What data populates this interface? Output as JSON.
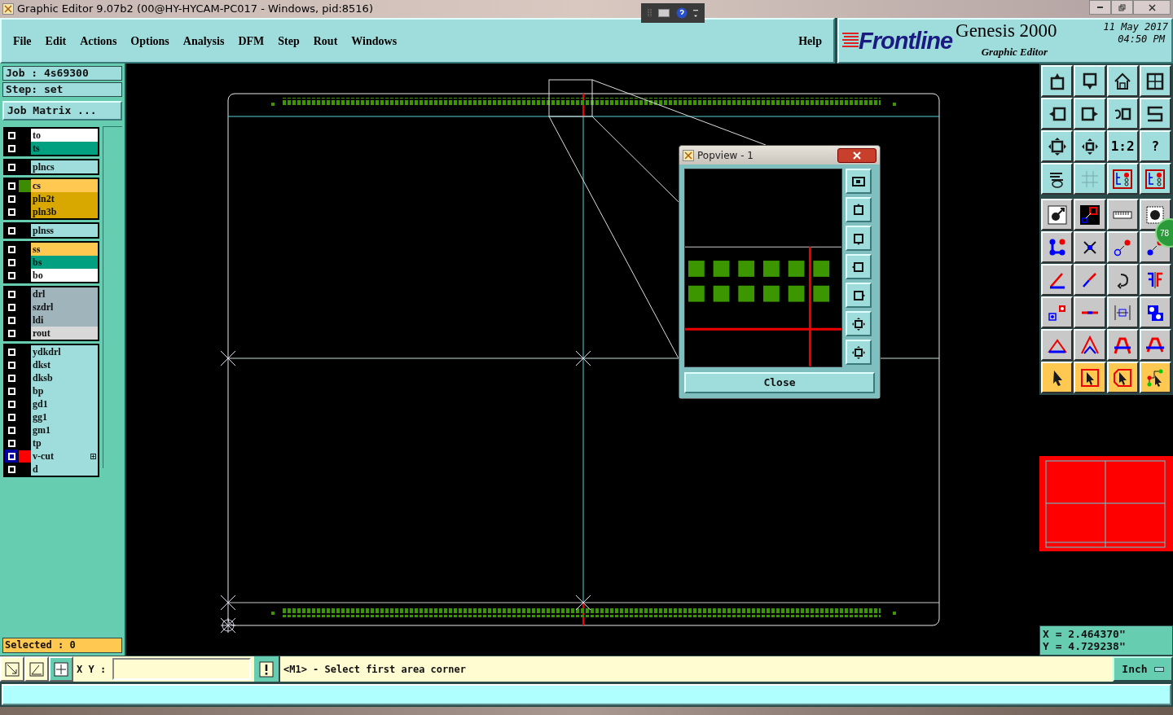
{
  "title_bar": {
    "title": "Graphic Editor 9.07b2 (00@HY-HYCAM-PC017 - Windows, pid:8516)"
  },
  "menu": {
    "items": [
      "File",
      "Edit",
      "Actions",
      "Options",
      "Analysis",
      "DFM",
      "Step",
      "Rout",
      "Windows"
    ],
    "help": "Help"
  },
  "brand": {
    "logo": "Frontline",
    "product": "Genesis 2000",
    "subtitle": "Graphic Editor",
    "date": "11 May 2017",
    "time": "04:50 PM"
  },
  "job": {
    "job": "Job : 4s69300",
    "step": "Step: set",
    "matrix_button": "Job Matrix ..."
  },
  "layer_groups": [
    {
      "layers": [
        {
          "name": "to",
          "color": "#ffffff",
          "displayed": false,
          "affected": false
        },
        {
          "name": "ts",
          "color": "#00a080",
          "displayed": false,
          "affected": false
        }
      ]
    },
    {
      "layers": [
        {
          "name": "plncs",
          "color": "#9fdcdc",
          "displayed": false,
          "affected": false
        }
      ]
    },
    {
      "layers": [
        {
          "name": "cs",
          "color": "#ffc850",
          "displayed": true,
          "swatch": {
            "color": "#3c8c00"
          },
          "affected": false
        },
        {
          "name": "pln2t",
          "color": "#d8a800",
          "displayed": false,
          "affected": false
        },
        {
          "name": "pln3b",
          "color": "#d8a800",
          "displayed": false,
          "affected": false
        }
      ]
    },
    {
      "layers": [
        {
          "name": "plnss",
          "color": "#9fdcdc",
          "displayed": false,
          "affected": false
        }
      ]
    },
    {
      "layers": [
        {
          "name": "ss",
          "color": "#ffc850",
          "displayed": false,
          "affected": false
        },
        {
          "name": "bs",
          "color": "#00a080",
          "displayed": false,
          "affected": false
        },
        {
          "name": "bo",
          "color": "#ffffff",
          "displayed": false,
          "affected": false
        }
      ]
    },
    {
      "layers": [
        {
          "name": "drl",
          "color": "#a0b4bc",
          "displayed": false,
          "affected": false
        },
        {
          "name": "szdrl",
          "color": "#a0b4bc",
          "displayed": false,
          "affected": false
        },
        {
          "name": "ldi",
          "color": "#a0b4bc",
          "displayed": false,
          "affected": false
        },
        {
          "name": "rout",
          "color": "#d8d8d8",
          "displayed": false,
          "affected": false
        }
      ]
    },
    {
      "layers": [
        {
          "name": "ydkdrl",
          "color": "#9fdcdc",
          "displayed": false,
          "affected": false
        },
        {
          "name": "dkst",
          "color": "#9fdcdc",
          "displayed": false,
          "affected": false
        },
        {
          "name": "dksb",
          "color": "#9fdcdc",
          "displayed": false,
          "affected": false
        },
        {
          "name": "bp",
          "color": "#9fdcdc",
          "displayed": false,
          "affected": false
        },
        {
          "name": "gd1",
          "color": "#9fdcdc",
          "displayed": false,
          "affected": false
        },
        {
          "name": "gg1",
          "color": "#9fdcdc",
          "displayed": false,
          "affected": false
        },
        {
          "name": "gm1",
          "color": "#9fdcdc",
          "displayed": false,
          "affected": false
        },
        {
          "name": "tp",
          "color": "#9fdcdc",
          "displayed": false,
          "affected": false
        },
        {
          "name": "v-cut",
          "color": "#9fdcdc",
          "displayed": true,
          "swatch": {
            "color": "#ff0000"
          },
          "affected": true
        },
        {
          "name": "d",
          "color": "#9fdcdc",
          "displayed": false,
          "affected": false
        }
      ]
    }
  ],
  "selected_count": "Selected : 0",
  "popview": {
    "title": "Popview - 1",
    "close": "Close"
  },
  "toolbar": {
    "labels": [
      "1:2",
      "?"
    ]
  },
  "badge": "78",
  "coordinates": {
    "x": "X = 2.464370\"",
    "y": "Y = 4.729238\""
  },
  "command_bar": {
    "label": "X Y :",
    "message": "<M1> - Select first area corner",
    "units": "Inch"
  }
}
